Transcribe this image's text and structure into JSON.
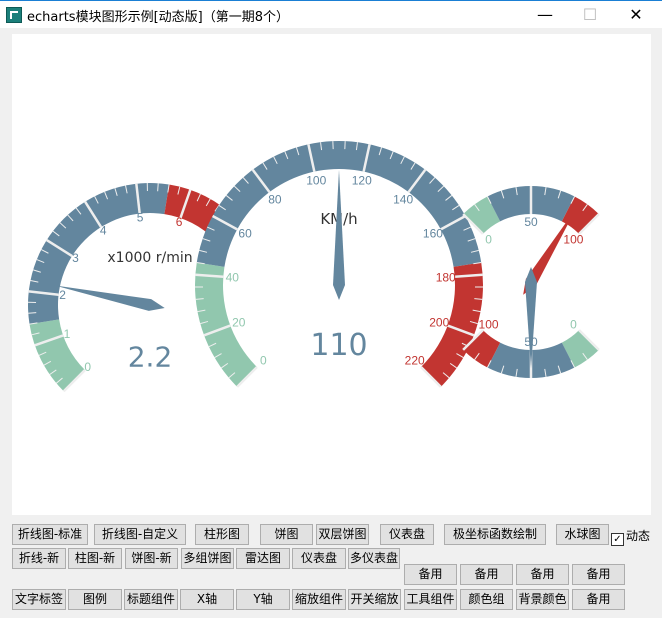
{
  "window": {
    "title": "echarts模块图形示例[动态版]（第一期8个）",
    "minimize": "—",
    "maximize": "☐",
    "close": "✕"
  },
  "colors": {
    "green": "#91c7ae",
    "blue": "#63869e",
    "red": "#c23531",
    "title": "#333333"
  },
  "gauges": [
    {
      "id": "rpm",
      "title": "x1000 r/min",
      "detail": "2.2",
      "value": 2.2,
      "min": 0,
      "max": 7,
      "start_angle": 225,
      "end_angle": 45,
      "labels": [
        "0",
        "1",
        "2",
        "3",
        "4",
        "5",
        "6"
      ],
      "bands": [
        [
          0.2,
          "#91c7ae"
        ],
        [
          0.8,
          "#63869e"
        ],
        [
          1,
          "#c23531"
        ]
      ],
      "pointer_color": "#63869e"
    },
    {
      "id": "speed",
      "title": "KM/h",
      "detail": "110",
      "value": 110,
      "min": 0,
      "max": 220,
      "start_angle": 225,
      "end_angle": -45,
      "labels": [
        "0",
        "20",
        "40",
        "60",
        "80",
        "100",
        "120",
        "140",
        "160",
        "180",
        "200",
        "220"
      ],
      "bands": [
        [
          0.2,
          "#91c7ae"
        ],
        [
          0.8,
          "#63869e"
        ],
        [
          1,
          "#c23531"
        ]
      ],
      "pointer_color": "#63869e"
    },
    {
      "id": "fuel-top",
      "value": 85,
      "min": 0,
      "max": 100,
      "start_angle": 135,
      "end_angle": 45,
      "labels": [
        "0",
        "50",
        "100"
      ],
      "bands": [
        [
          0.2,
          "#91c7ae"
        ],
        [
          0.8,
          "#63869e"
        ],
        [
          1,
          "#c23531"
        ]
      ],
      "pointer_color": "#c23531"
    },
    {
      "id": "fuel-bottom",
      "value": 50,
      "min": 0,
      "max": 100,
      "start_angle": 315,
      "end_angle": 225,
      "labels": [
        "0",
        "50",
        "100"
      ],
      "bands": [
        [
          0.2,
          "#91c7ae"
        ],
        [
          0.8,
          "#63869e"
        ],
        [
          1,
          "#c23531"
        ]
      ],
      "pointer_color": "#63869e"
    }
  ],
  "buttons": {
    "row1": [
      "折线图-标准",
      "折线图-自定义",
      "柱形图",
      "饼图",
      "双层饼图",
      "仪表盘",
      "极坐标函数绘制",
      "水球图"
    ],
    "row2": [
      "折线-新",
      "柱图-新",
      "饼图-新",
      "多组饼图",
      "雷达图",
      "仪表盘",
      "多仪表盘"
    ],
    "row3": [
      "备用",
      "备用",
      "备用",
      "备用"
    ],
    "row4": [
      "文字标签",
      "图例",
      "标题组件",
      "X轴",
      "Y轴",
      "缩放组件",
      "开关缩放",
      "工具组件",
      "颜色组",
      "背景颜色",
      "备用"
    ]
  },
  "dynamic_checkbox": {
    "label": "动态",
    "checked": true
  }
}
